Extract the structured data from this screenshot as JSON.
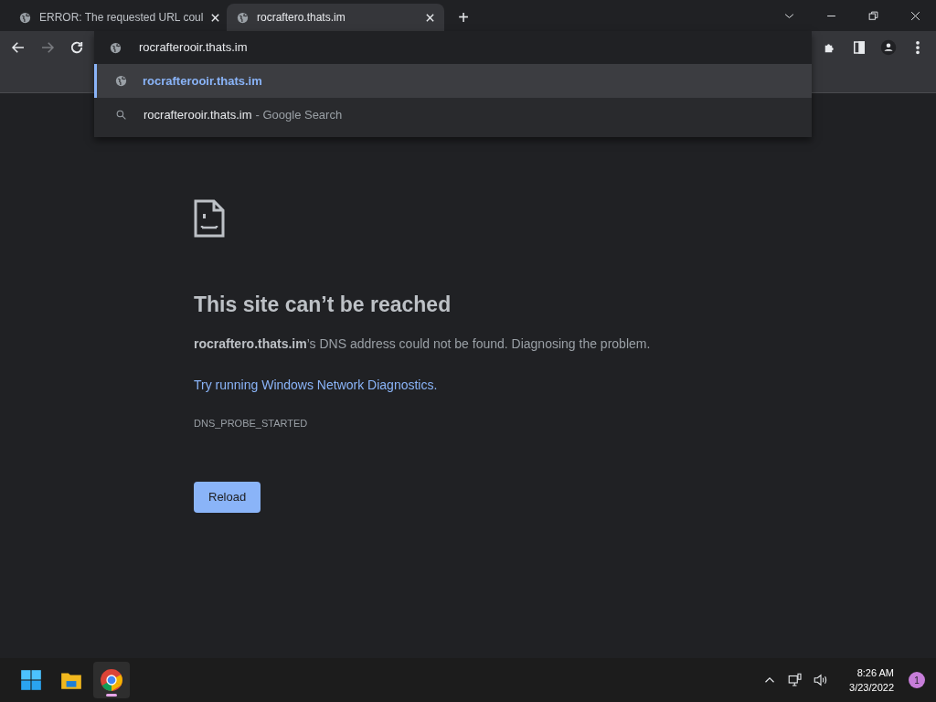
{
  "tabs": [
    {
      "title": "ERROR: The requested URL coul",
      "selected": false
    },
    {
      "title": "rocraftero.thats.im",
      "selected": true
    }
  ],
  "new_tab": "+",
  "toolbar": {
    "forward_disabled": true
  },
  "omnibox": {
    "value": "rocrafterooir.thats.im"
  },
  "suggestions": [
    {
      "kind": "url",
      "text": "rocrafterooir.thats.im",
      "selected": true
    },
    {
      "kind": "search",
      "text": "rocrafterooir.thats.im",
      "suffix": "- Google Search",
      "selected": false
    }
  ],
  "error": {
    "heading": "This site can’t be reached",
    "message": "**rocraftero.thats.im**’s DNS address could not be found. Diagnosing the problem.",
    "link": "Try running Windows Network Diagnostics.",
    "code": "DNS_PROBE_STARTED",
    "button": "Reload"
  },
  "taskbar": {
    "apps": [
      {
        "kind": "start",
        "selected": false
      },
      {
        "kind": "explorer",
        "selected": false
      },
      {
        "kind": "chrome",
        "selected": true
      }
    ],
    "time": "8:26 AM",
    "date": "3/23/2022",
    "notifications": "1"
  }
}
